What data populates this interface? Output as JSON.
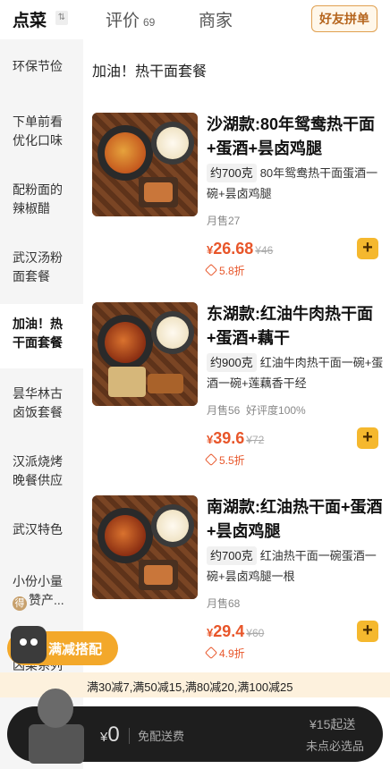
{
  "tabs": {
    "dine_label": "点菜",
    "review_label": "评价",
    "review_count": "69",
    "shop_label": "商家",
    "group_order_label": "好友拼单"
  },
  "sidebar": {
    "items": [
      {
        "label": "环保节俭"
      },
      {
        "label": "下单前看优化口味"
      },
      {
        "label": "配粉面的辣椒醋"
      },
      {
        "label": "武汉汤粉面套餐"
      },
      {
        "label": "加油！热干面套餐"
      },
      {
        "label": "昙华林古卤饭套餐"
      },
      {
        "label": "汉派烧烤晚餐供应"
      },
      {
        "label": "武汉特色"
      },
      {
        "label": "小份小量",
        "badge": "得",
        "label2": "赞产..."
      },
      {
        "label": "凶菜系列"
      }
    ]
  },
  "section": {
    "title": "加油！热干面套餐"
  },
  "dishes": [
    {
      "name": "沙湖款:80年鸳鸯热干面+蛋酒+昙卤鸡腿",
      "weight": "约700克",
      "desc": "80年鸳鸯热干面蛋酒一碗+昙卤鸡腿",
      "sales": "月售27",
      "rating": "",
      "currency": "¥",
      "price": "26.68",
      "original_price": "¥46",
      "discount": "5.8折"
    },
    {
      "name": "东湖款:红油牛肉热干面+蛋酒+藕干",
      "weight": "约900克",
      "desc": "红油牛肉热干面一碗+蛋酒一碗+莲藕香干经",
      "sales": "月售56",
      "rating": "好评度100%",
      "currency": "¥",
      "price": "39.6",
      "original_price": "¥72",
      "discount": "5.5折"
    },
    {
      "name": "南湖款:红油热干面+蛋酒+昙卤鸡腿",
      "weight": "约700克",
      "desc": "红油热干面一碗蛋酒一碗+昙卤鸡腿一根",
      "sales": "月售68",
      "rating": "",
      "currency": "¥",
      "price": "29.4",
      "original_price": "¥60",
      "discount": "4.9折"
    }
  ],
  "promo": {
    "label": "满减搭配",
    "tiers": "满30减7,满50减15,满80减20,满100减25"
  },
  "cart": {
    "currency": "¥",
    "total": "0",
    "delivery": "免配送费",
    "min_order": "¥15起送",
    "required_note": "未点必选品"
  },
  "colors": {
    "accent": "#f5b82e",
    "price": "#e8562a",
    "cart_bg": "#1e1e1e"
  }
}
